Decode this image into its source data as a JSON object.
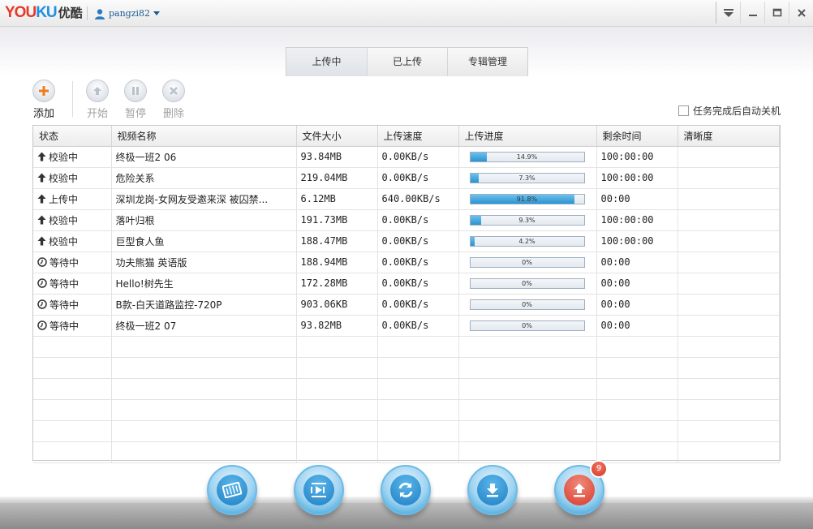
{
  "app": {
    "logo_you": "YOU",
    "logo_ku": "KU",
    "logo_cn": "优酷",
    "username": "pangzi82"
  },
  "tabs": [
    {
      "label": "上传中"
    },
    {
      "label": "已上传"
    },
    {
      "label": "专辑管理"
    }
  ],
  "toolbar": {
    "add": "添加",
    "start": "开始",
    "pause": "暂停",
    "delete": "删除",
    "auto_shutdown": "任务完成后自动关机"
  },
  "table": {
    "headers": [
      "状态",
      "视频名称",
      "文件大小",
      "上传速度",
      "上传进度",
      "剩余时间",
      "清晰度"
    ],
    "rows": [
      {
        "status": "校验中",
        "status_icon": "arrow-up-icon",
        "name": "终极一班2 06",
        "size": "93.84MB",
        "speed": "0.00KB/s",
        "progress": 14.9,
        "progress_text": "14.9%",
        "remaining": "100:00:00",
        "quality": ""
      },
      {
        "status": "校验中",
        "status_icon": "arrow-up-icon",
        "name": "危险关系",
        "size": "219.04MB",
        "speed": "0.00KB/s",
        "progress": 7.3,
        "progress_text": "7.3%",
        "remaining": "100:00:00",
        "quality": ""
      },
      {
        "status": "上传中",
        "status_icon": "arrow-up-icon",
        "name": "深圳龙岗-女网友受邀来深 被囚禁...",
        "size": "6.12MB",
        "speed": "640.00KB/s",
        "progress": 91.8,
        "progress_text": "91.8%",
        "remaining": "00:00",
        "quality": ""
      },
      {
        "status": "校验中",
        "status_icon": "arrow-up-icon",
        "name": "落叶归根",
        "size": "191.73MB",
        "speed": "0.00KB/s",
        "progress": 9.3,
        "progress_text": "9.3%",
        "remaining": "100:00:00",
        "quality": ""
      },
      {
        "status": "校验中",
        "status_icon": "arrow-up-icon",
        "name": "巨型食人鱼",
        "size": "188.47MB",
        "speed": "0.00KB/s",
        "progress": 4.2,
        "progress_text": "4.2%",
        "remaining": "100:00:00",
        "quality": ""
      },
      {
        "status": "等待中",
        "status_icon": "clock-icon",
        "name": "功夫熊猫  英语版",
        "size": "188.94MB",
        "speed": "0.00KB/s",
        "progress": 0,
        "progress_text": "0%",
        "remaining": "00:00",
        "quality": ""
      },
      {
        "status": "等待中",
        "status_icon": "clock-icon",
        "name": "Hello!树先生",
        "size": "172.28MB",
        "speed": "0.00KB/s",
        "progress": 0,
        "progress_text": "0%",
        "remaining": "00:00",
        "quality": ""
      },
      {
        "status": "等待中",
        "status_icon": "clock-icon",
        "name": "B款-白天道路监控-720P",
        "size": "903.06KB",
        "speed": "0.00KB/s",
        "progress": 0,
        "progress_text": "0%",
        "remaining": "00:00",
        "quality": ""
      },
      {
        "status": "等待中",
        "status_icon": "clock-icon",
        "name": "终极一班2 07",
        "size": "93.82MB",
        "speed": "0.00KB/s",
        "progress": 0,
        "progress_text": "0%",
        "remaining": "00:00",
        "quality": ""
      }
    ]
  },
  "footer": {
    "buttons": [
      "film-icon",
      "playlist-icon",
      "refresh-icon",
      "download-icon",
      "upload-icon"
    ],
    "upload_badge": "9"
  },
  "colors": {
    "progress_fill": "#2a93d2",
    "logo_red": "#e5392a",
    "logo_blue": "#1e8fe0",
    "upload_red": "#d83a2b"
  }
}
